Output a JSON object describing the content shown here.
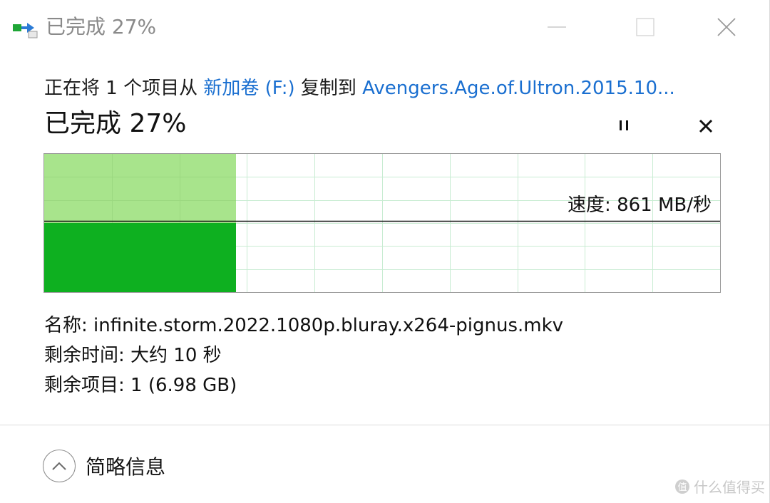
{
  "window": {
    "title": "已完成 27%"
  },
  "header": {
    "copy_prefix": "正在将 1 个项目从",
    "source": "新加卷 (F:)",
    "copy_mid": "复制到",
    "destination": "Avengers.Age.of.Ultron.2015.10...",
    "status": "已完成 27%"
  },
  "controls": {
    "pause_icon": "pause-icon",
    "cancel_icon": "close-icon"
  },
  "progress": {
    "percent": 27,
    "speed_label": "速度: 861 MB/秒",
    "speed_level_fraction": 0.5,
    "colors": {
      "completed_area": "#a8e48c",
      "speed_area": "#0eb020",
      "grid": "#c8ecd2",
      "speed_line": "#111111"
    }
  },
  "details": {
    "name_label": "名称:",
    "name_value": "infinite.storm.2022.1080p.bluray.x264-pignus.mkv",
    "time_label": "剩余时间:",
    "time_value": "大约 10 秒",
    "items_label": "剩余项目:",
    "items_value": "1 (6.98 GB)"
  },
  "footer": {
    "toggle_label": "简略信息"
  },
  "watermark": {
    "badge": "值",
    "text": "什么值得买"
  }
}
